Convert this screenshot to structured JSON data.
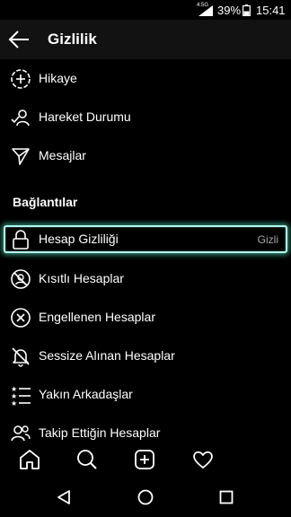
{
  "status_bar": {
    "network": "4.5G",
    "battery_percent": "39%",
    "time": "15:41"
  },
  "header": {
    "title": "Gizlilik",
    "back_icon": "arrow-left-icon"
  },
  "menu": {
    "items_top": [
      {
        "label": "Hikaye",
        "icon": "story-add-icon"
      },
      {
        "label": "Hareket Durumu",
        "icon": "activity-status-icon"
      },
      {
        "label": "Mesajlar",
        "icon": "send-icon"
      }
    ],
    "section_title": "Bağlantılar",
    "items_connections": [
      {
        "label": "Hesap Gizliliği",
        "icon": "lock-icon",
        "value": "Gizli"
      },
      {
        "label": "Kısıtlı Hesaplar",
        "icon": "restricted-icon"
      },
      {
        "label": "Engellenen Hesaplar",
        "icon": "blocked-icon"
      },
      {
        "label": "Sessize Alınan Hesaplar",
        "icon": "muted-bell-icon"
      },
      {
        "label": "Yakın Arkadaşlar",
        "icon": "close-friends-list-icon"
      },
      {
        "label": "Takip Ettiğin Hesaplar",
        "icon": "following-icon"
      }
    ]
  },
  "bottom_nav": [
    "home-icon",
    "search-icon",
    "add-post-icon",
    "heart-icon"
  ],
  "system_nav": [
    "back-triangle-icon",
    "home-circle-icon",
    "recents-square-icon"
  ],
  "colors": {
    "background": "#000000",
    "header_bg": "#121212",
    "highlight_border": "#b8fff0",
    "secondary_text": "#a8a8a8"
  }
}
